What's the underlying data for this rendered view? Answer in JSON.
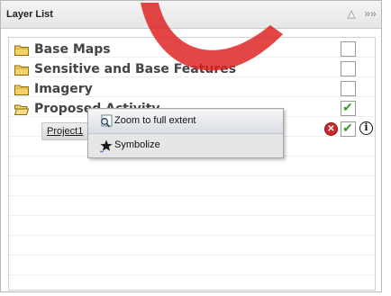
{
  "panel": {
    "title": "Layer List"
  },
  "layers": [
    {
      "label": "Base Maps",
      "checked": false
    },
    {
      "label": "Sensitive and Base Features",
      "checked": false
    },
    {
      "label": "Imagery",
      "checked": false
    },
    {
      "label": "Proposed Activity",
      "checked": true
    }
  ],
  "sublayer": {
    "label": "Project1",
    "checked": true
  },
  "context_menu": {
    "items": [
      {
        "label": "Zoom to full extent"
      },
      {
        "label": "Symbolize"
      }
    ]
  }
}
